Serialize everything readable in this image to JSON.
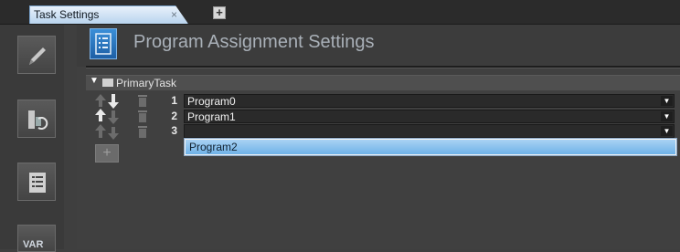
{
  "tab": {
    "title": "Task Settings",
    "close": "×",
    "add": "+"
  },
  "sidebar": {
    "items": [
      {
        "name": "pencil-icon"
      },
      {
        "name": "io-assign-icon"
      },
      {
        "name": "program-list-icon"
      },
      {
        "name": "var-icon",
        "label": "VAR"
      }
    ]
  },
  "header": {
    "title": "Program Assignment Settings"
  },
  "task": {
    "name": "PrimaryTask",
    "rows": [
      {
        "num": "1",
        "value": "Program0"
      },
      {
        "num": "2",
        "value": "Program1"
      },
      {
        "num": "3",
        "value": ""
      }
    ]
  },
  "dropdown": {
    "options": [
      "Program2"
    ]
  },
  "add_button": "+",
  "colors": {
    "accent": "#6fb2e8",
    "tab": "#b9d4ee",
    "background": "#3f3f3f"
  }
}
